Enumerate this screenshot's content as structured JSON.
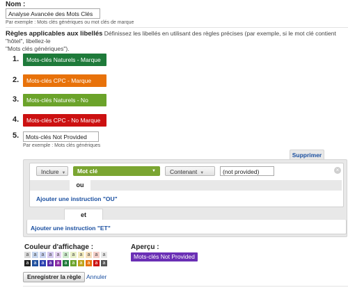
{
  "name": {
    "label": "Nom :",
    "value": "Analyse Avancée des Mots Clés",
    "hint": "Par exemple : Mots clés génériques ou mot clés de marque"
  },
  "rules_section": {
    "title": "Règles applicables aux libellés",
    "description_line1": "Définissez les libellés en utilisant des règles précises (par exemple, si le mot clé contient \"hôtel\", libellez-le",
    "description_line2": "\"Mots clés génériques\")."
  },
  "rules": [
    {
      "number": "1.",
      "label": "Mots-clés Naturels - Marque",
      "color": "#1e7a3a"
    },
    {
      "number": "2.",
      "label": "Mots-clés CPC - Marque",
      "color": "#e8720a"
    },
    {
      "number": "3.",
      "label": "Mots-clés Naturels - No Marque",
      "color": "#6ba32a"
    },
    {
      "number": "4.",
      "label": "Mots-clés CPC - No Marque",
      "color": "#cc1111"
    }
  ],
  "rule5": {
    "number": "5.",
    "value": "Mots-clés Not Provided",
    "hint": "Par exemple : Mots clés génériques"
  },
  "editor": {
    "delete_label": "Supprimer",
    "condition": {
      "include": "Inclure",
      "dimension": "Mot clé",
      "dimension_color": "#7aa531",
      "operator": "Contenant",
      "value": "(not provided)"
    },
    "or_label": "ou",
    "add_or": "Ajouter une instruction \"OU\"",
    "and_label": "et",
    "add_and": "Ajouter une instruction \"ET\""
  },
  "display": {
    "color_label": "Couleur d'affichage :",
    "preview_label": "Aperçu :",
    "preview_text": "Mots-clés Not Provided",
    "preview_color": "#6a2fb5",
    "swatch_letter": "a",
    "light_swatches": [
      "#d9d9d9",
      "#c6d6ee",
      "#c8d2f0",
      "#d4c8ef",
      "#e6d3f2",
      "#cdeacc",
      "#e7efc6",
      "#f4ecbf",
      "#f6dfbd",
      "#f3cfc9",
      "#e8e8e8"
    ],
    "dark_swatches": [
      "#202020",
      "#1f4f9e",
      "#2a3fb0",
      "#5a2aa8",
      "#8a2aa3",
      "#1e7a3a",
      "#6ba32a",
      "#bda21a",
      "#e8720a",
      "#cc1111",
      "#555555"
    ]
  },
  "actions": {
    "save": "Enregistrer la règle",
    "cancel": "Annuler"
  }
}
